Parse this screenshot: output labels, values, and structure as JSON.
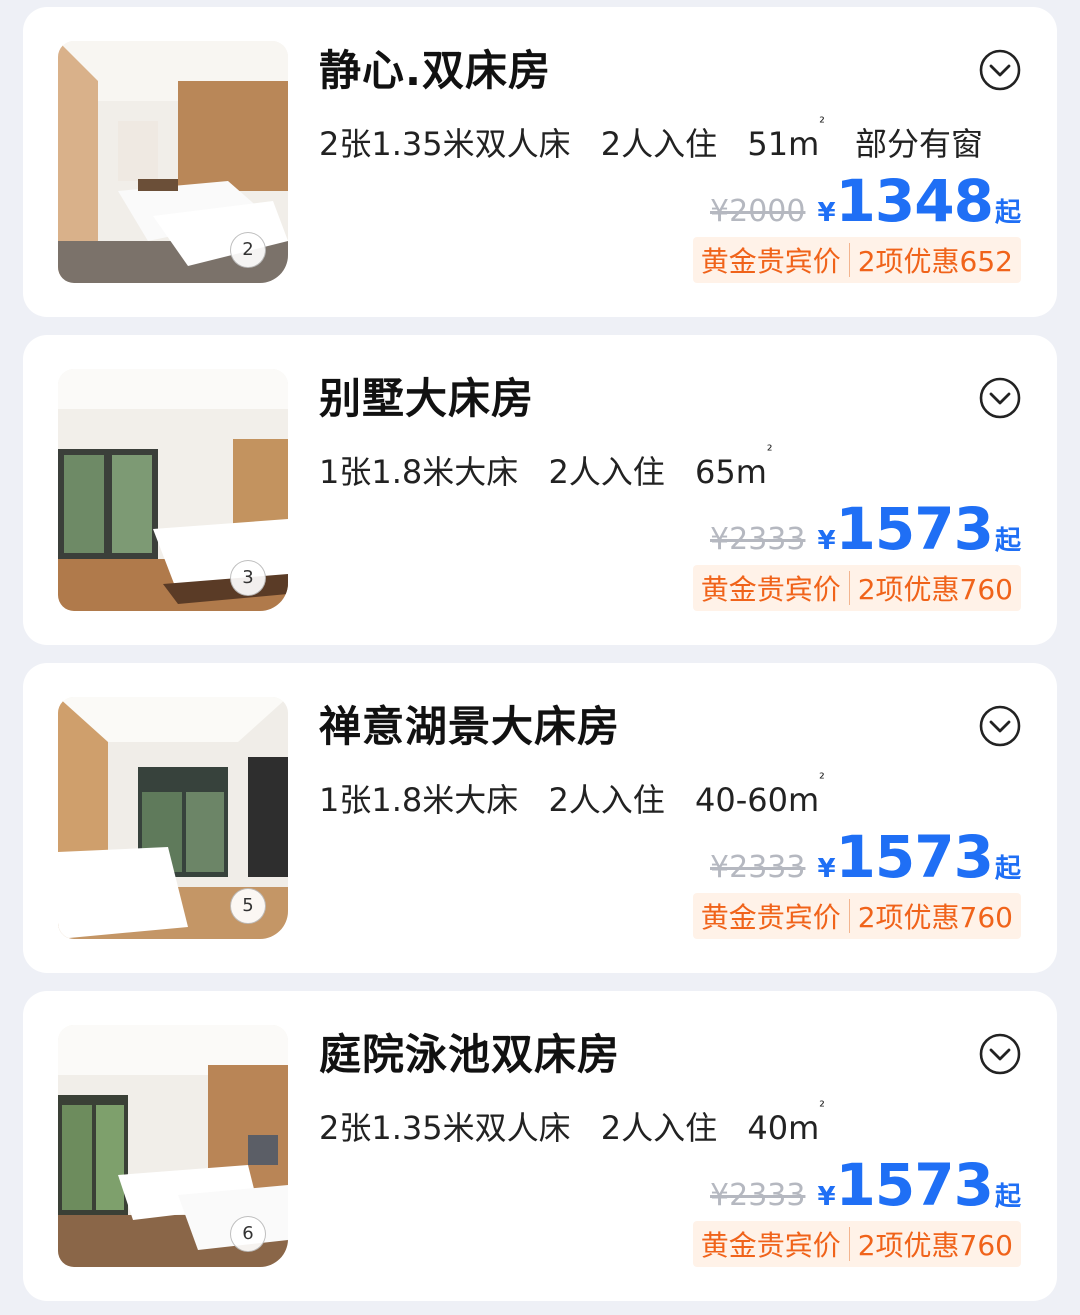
{
  "rooms": [
    {
      "name": "静心.双床房",
      "bed": "2张1.35米双人床",
      "guests": "2人入住",
      "area": "51m",
      "area_sup": "²",
      "window": "部分有窗",
      "photo_count": "2",
      "original_price": "¥2000",
      "currency": "¥",
      "price": "1348",
      "price_suffix": "起",
      "tag_member": "黄金贵宾价",
      "tag_discount": "2项优惠652"
    },
    {
      "name": "别墅大床房",
      "bed": "1张1.8米大床",
      "guests": "2人入住",
      "area": "65m",
      "area_sup": "²",
      "photo_count": "3",
      "original_price": "¥2333",
      "currency": "¥",
      "price": "1573",
      "price_suffix": "起",
      "tag_member": "黄金贵宾价",
      "tag_discount": "2项优惠760"
    },
    {
      "name": "禅意湖景大床房",
      "bed": "1张1.8米大床",
      "guests": "2人入住",
      "area": "40-60m",
      "area_sup": "²",
      "photo_count": "5",
      "original_price": "¥2333",
      "currency": "¥",
      "price": "1573",
      "price_suffix": "起",
      "tag_member": "黄金贵宾价",
      "tag_discount": "2项优惠760"
    },
    {
      "name": "庭院泳池双床房",
      "bed": "2张1.35米双人床",
      "guests": "2人入住",
      "area": "40m",
      "area_sup": "²",
      "photo_count": "6",
      "original_price": "¥2333",
      "currency": "¥",
      "price": "1573",
      "price_suffix": "起",
      "tag_member": "黄金贵宾价",
      "tag_discount": "2项优惠760"
    }
  ],
  "colors": {
    "accent_price": "#1f6ff5",
    "tag_text": "#f0631a",
    "tag_bg": "#fff2e8",
    "page_bg": "#eef0f6"
  },
  "icons": {
    "expand": "chevron-down-circle-icon"
  }
}
